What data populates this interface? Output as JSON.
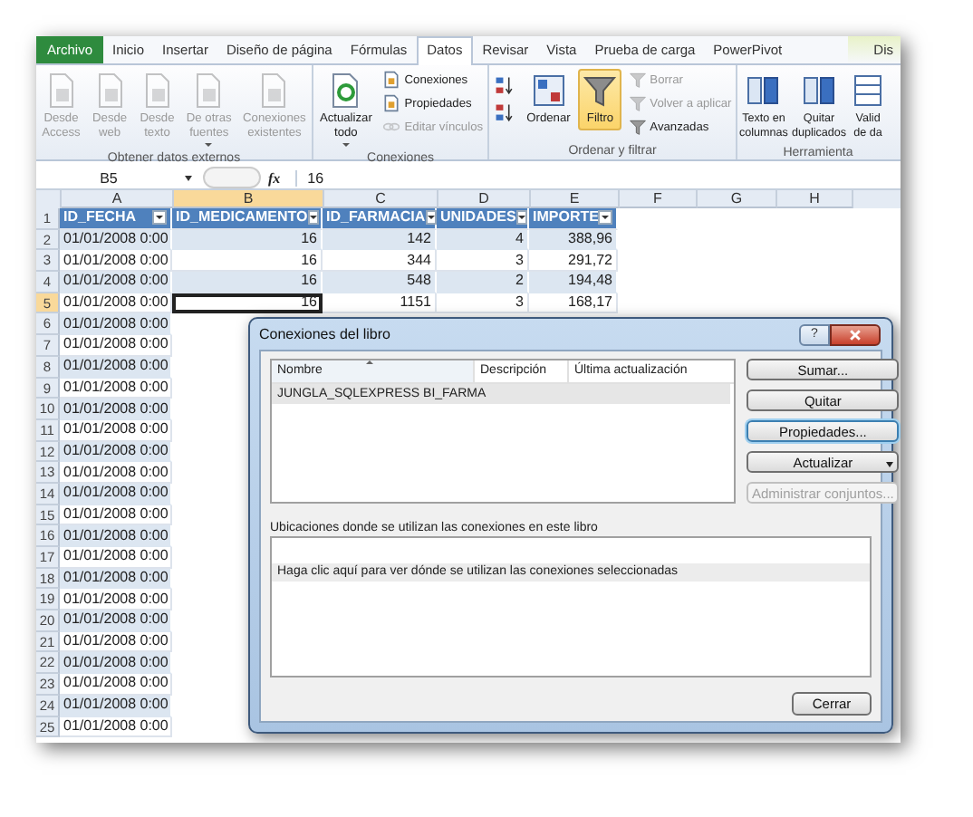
{
  "ribbon_tabs": [
    {
      "label": "Archivo",
      "kind": "file",
      "selected": false
    },
    {
      "label": "Inicio",
      "kind": "normal",
      "selected": false
    },
    {
      "label": "Insertar",
      "kind": "normal",
      "selected": false
    },
    {
      "label": "Diseño de página",
      "kind": "normal",
      "selected": false
    },
    {
      "label": "Fórmulas",
      "kind": "normal",
      "selected": false
    },
    {
      "label": "Datos",
      "kind": "normal",
      "selected": true
    },
    {
      "label": "Revisar",
      "kind": "normal",
      "selected": false
    },
    {
      "label": "Vista",
      "kind": "normal",
      "selected": false
    },
    {
      "label": "Prueba de carga",
      "kind": "normal",
      "selected": false
    },
    {
      "label": "PowerPivot",
      "kind": "normal",
      "selected": false
    },
    {
      "label": "Dis",
      "kind": "contextual",
      "selected": false
    }
  ],
  "ribbon_groups": [
    {
      "label": "Obtener datos externos",
      "items": [
        {
          "kind": "large",
          "lines": [
            "Desde",
            "Access"
          ],
          "disabled": true,
          "selected": false,
          "dropdown": false
        },
        {
          "kind": "large",
          "lines": [
            "Desde",
            "web"
          ],
          "disabled": true,
          "selected": false,
          "dropdown": false
        },
        {
          "kind": "large",
          "lines": [
            "Desde",
            "texto"
          ],
          "disabled": true,
          "selected": false,
          "dropdown": false
        },
        {
          "kind": "large",
          "lines": [
            "De otras",
            "fuentes"
          ],
          "disabled": true,
          "selected": false,
          "dropdown": true
        },
        {
          "kind": "large",
          "lines": [
            "Conexiones",
            "existentes"
          ],
          "disabled": true,
          "selected": false,
          "dropdown": false
        }
      ]
    },
    {
      "label": "Conexiones",
      "items": [
        {
          "kind": "large",
          "lines": [
            "Actualizar",
            "todo"
          ],
          "disabled": false,
          "selected": false,
          "dropdown": true
        },
        {
          "kind": "stack",
          "items": [
            {
              "label": "Conexiones",
              "disabled": false
            },
            {
              "label": "Propiedades",
              "disabled": false
            },
            {
              "label": "Editar vínculos",
              "disabled": true
            }
          ]
        }
      ]
    },
    {
      "label": "Ordenar y filtrar",
      "items": [
        {
          "kind": "sort_pair"
        },
        {
          "kind": "large",
          "lines": [
            "Ordenar"
          ],
          "disabled": false,
          "selected": false,
          "dropdown": false
        },
        {
          "kind": "large",
          "lines": [
            "Filtro"
          ],
          "disabled": false,
          "selected": true,
          "dropdown": false
        },
        {
          "kind": "stack",
          "items": [
            {
              "label": "Borrar",
              "disabled": true
            },
            {
              "label": "Volver a aplicar",
              "disabled": true
            },
            {
              "label": "Avanzadas",
              "disabled": false
            }
          ]
        }
      ]
    },
    {
      "label": "Herramienta",
      "items": [
        {
          "kind": "large",
          "lines": [
            "Texto en",
            "columnas"
          ],
          "disabled": false,
          "selected": false,
          "dropdown": false
        },
        {
          "kind": "large",
          "lines": [
            "Quitar",
            "duplicados"
          ],
          "disabled": false,
          "selected": false,
          "dropdown": false
        },
        {
          "kind": "large",
          "lines": [
            "Valid",
            "de da"
          ],
          "disabled": false,
          "selected": false,
          "dropdown": false
        }
      ]
    }
  ],
  "formula_bar": {
    "name_box": "B5",
    "fx": "fx",
    "value": "16"
  },
  "grid": {
    "columns": [
      {
        "label": "A",
        "selected": false
      },
      {
        "label": "B",
        "selected": true
      },
      {
        "label": "C",
        "selected": false
      },
      {
        "label": "D",
        "selected": false
      },
      {
        "label": "E",
        "selected": false
      },
      {
        "label": "F",
        "selected": false
      },
      {
        "label": "G",
        "selected": false
      },
      {
        "label": "H",
        "selected": false
      }
    ],
    "rows": [
      {
        "number": "1",
        "kind": "header",
        "selected": false,
        "cells": [
          "ID_FECHA",
          "ID_MEDICAMENTO",
          "ID_FARMACIA",
          "UNIDADES",
          "IMPORTE"
        ]
      },
      {
        "number": "2",
        "kind": "data",
        "selected": false,
        "cells": [
          "01/01/2008 0:00",
          "16",
          "142",
          "4",
          "388,96"
        ]
      },
      {
        "number": "3",
        "kind": "data",
        "selected": false,
        "cells": [
          "01/01/2008 0:00",
          "16",
          "344",
          "3",
          "291,72"
        ]
      },
      {
        "number": "4",
        "kind": "data",
        "selected": false,
        "cells": [
          "01/01/2008 0:00",
          "16",
          "548",
          "2",
          "194,48"
        ]
      },
      {
        "number": "5",
        "kind": "data",
        "selected": true,
        "cells": [
          "01/01/2008 0:00",
          "16",
          "1151",
          "3",
          "168,17"
        ]
      },
      {
        "number": "6",
        "kind": "data",
        "selected": false,
        "cells": [
          "01/01/2008 0:00"
        ]
      },
      {
        "number": "7",
        "kind": "data",
        "selected": false,
        "cells": [
          "01/01/2008 0:00"
        ]
      },
      {
        "number": "8",
        "kind": "data",
        "selected": false,
        "cells": [
          "01/01/2008 0:00"
        ]
      },
      {
        "number": "9",
        "kind": "data",
        "selected": false,
        "cells": [
          "01/01/2008 0:00"
        ]
      },
      {
        "number": "10",
        "kind": "data",
        "selected": false,
        "cells": [
          "01/01/2008 0:00"
        ]
      },
      {
        "number": "11",
        "kind": "data",
        "selected": false,
        "cells": [
          "01/01/2008 0:00"
        ]
      },
      {
        "number": "12",
        "kind": "data",
        "selected": false,
        "cells": [
          "01/01/2008 0:00"
        ]
      },
      {
        "number": "13",
        "kind": "data",
        "selected": false,
        "cells": [
          "01/01/2008 0:00"
        ]
      },
      {
        "number": "14",
        "kind": "data",
        "selected": false,
        "cells": [
          "01/01/2008 0:00"
        ]
      },
      {
        "number": "15",
        "kind": "data",
        "selected": false,
        "cells": [
          "01/01/2008 0:00"
        ]
      },
      {
        "number": "16",
        "kind": "data",
        "selected": false,
        "cells": [
          "01/01/2008 0:00"
        ]
      },
      {
        "number": "17",
        "kind": "data",
        "selected": false,
        "cells": [
          "01/01/2008 0:00"
        ]
      },
      {
        "number": "18",
        "kind": "data",
        "selected": false,
        "cells": [
          "01/01/2008 0:00"
        ]
      },
      {
        "number": "19",
        "kind": "data",
        "selected": false,
        "cells": [
          "01/01/2008 0:00"
        ]
      },
      {
        "number": "20",
        "kind": "data",
        "selected": false,
        "cells": [
          "01/01/2008 0:00"
        ]
      },
      {
        "number": "21",
        "kind": "data",
        "selected": false,
        "cells": [
          "01/01/2008 0:00"
        ]
      },
      {
        "number": "22",
        "kind": "data",
        "selected": false,
        "cells": [
          "01/01/2008 0:00"
        ]
      },
      {
        "number": "23",
        "kind": "data",
        "selected": false,
        "cells": [
          "01/01/2008 0:00"
        ]
      },
      {
        "number": "24",
        "kind": "data",
        "selected": false,
        "cells": [
          "01/01/2008 0:00"
        ]
      },
      {
        "number": "25",
        "kind": "data",
        "selected": false,
        "cells": [
          "01/01/2008 0:00"
        ]
      }
    ]
  },
  "dialog": {
    "title": "Conexiones del libro",
    "help": "?",
    "list": {
      "columns": [
        "Nombre",
        "Descripción",
        "Última actualización"
      ],
      "rows": [
        {
          "cells": [
            "JUNGLA_SQLEXPRESS BI_FARMA"
          ],
          "selected": true
        }
      ]
    },
    "buttons": [
      {
        "label": "Sumar...",
        "kind": "plain",
        "disabled": false,
        "focused": false
      },
      {
        "label": "Quitar",
        "kind": "plain",
        "disabled": false,
        "focused": false
      },
      {
        "label": "Propiedades...",
        "kind": "plain",
        "disabled": false,
        "focused": true
      },
      {
        "label": "Actualizar",
        "kind": "dropdown",
        "disabled": false,
        "focused": false
      },
      {
        "label": "Administrar conjuntos...",
        "kind": "plain",
        "disabled": true,
        "focused": false
      }
    ],
    "locations_label": "Ubicaciones donde se utilizan las conexiones en este libro",
    "locations_hint": "Haga clic aquí para ver dónde se utilizan las conexiones seleccionadas",
    "close_button": "Cerrar"
  }
}
